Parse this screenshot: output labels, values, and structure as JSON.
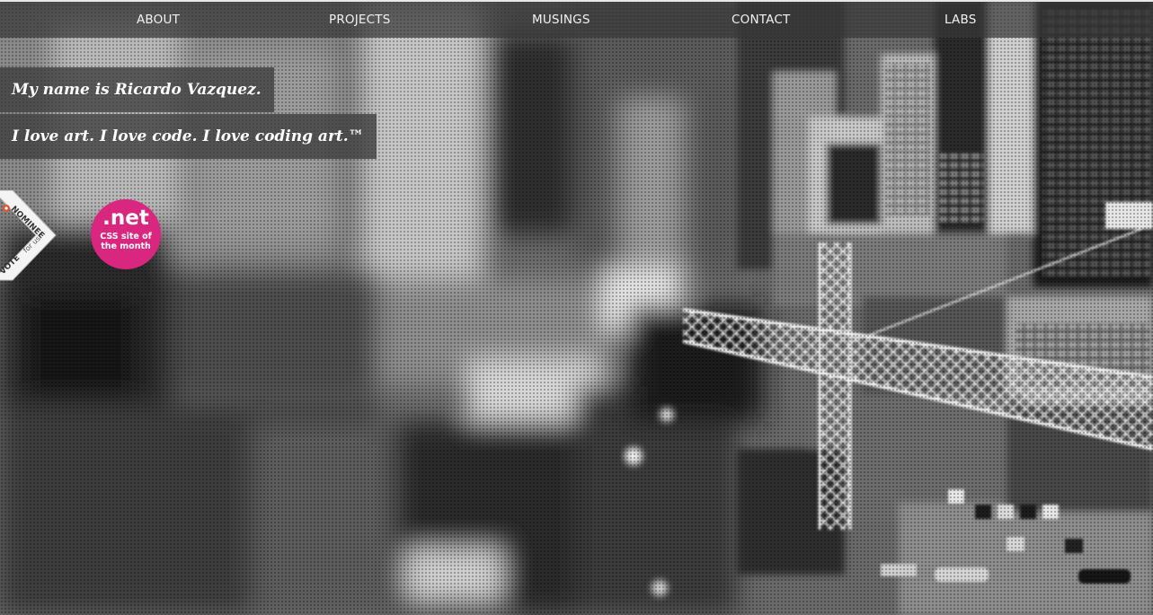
{
  "nav": {
    "items": [
      {
        "label": "ABOUT"
      },
      {
        "label": "PROJECTS"
      },
      {
        "label": "MUSINGS"
      },
      {
        "label": "CONTACT"
      },
      {
        "label": "LABS"
      }
    ]
  },
  "hero": {
    "name_line": "My name is Ricardo Vazquez.",
    "tagline": "I love art. I love code. I love coding art.™"
  },
  "badges": {
    "nominee": {
      "label": "NOMINEE",
      "vote_label": "VOTE",
      "vote_suffix": "for us",
      "icon": "award-rosette-icon"
    },
    "net": {
      "brand": ".net",
      "line1": "CSS site of",
      "line2": "the month",
      "color": "#d9267f"
    }
  },
  "colors": {
    "nav_text": "#f2f2f2",
    "accent": "#d9267f"
  }
}
